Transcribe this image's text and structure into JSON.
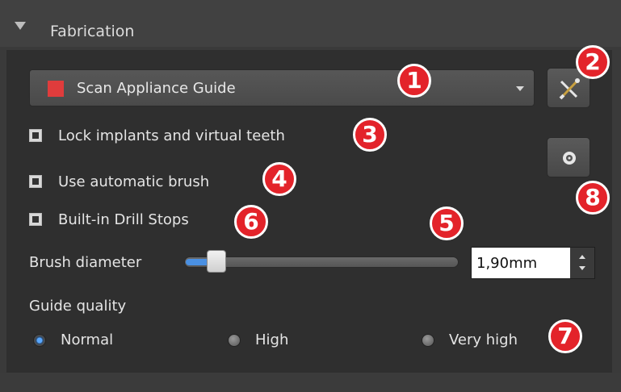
{
  "section": {
    "title": "Fabrication"
  },
  "guide_select": {
    "value": "Scan Appliance Guide",
    "color": "#e03c3c"
  },
  "buttons": {
    "tools_icon": "tools-icon",
    "system_icon": "system-icon"
  },
  "checkboxes": [
    {
      "label": "Lock implants and virtual teeth",
      "checked": true
    },
    {
      "label": "Use automatic brush",
      "checked": true
    },
    {
      "label": "Built-in Drill Stops",
      "checked": true
    }
  ],
  "brush": {
    "label": "Brush diameter",
    "value": "1,90mm",
    "fraction": 0.09
  },
  "quality": {
    "label": "Guide quality",
    "options": [
      {
        "label": "Normal",
        "checked": true
      },
      {
        "label": "High",
        "checked": false
      },
      {
        "label": "Very high",
        "checked": false
      }
    ]
  },
  "badges": [
    "1",
    "2",
    "3",
    "4",
    "5",
    "6",
    "7",
    "8"
  ],
  "colors": {
    "badge": "#e3232a",
    "accent": "#4a90e2",
    "panel": "#2f2f2f"
  }
}
